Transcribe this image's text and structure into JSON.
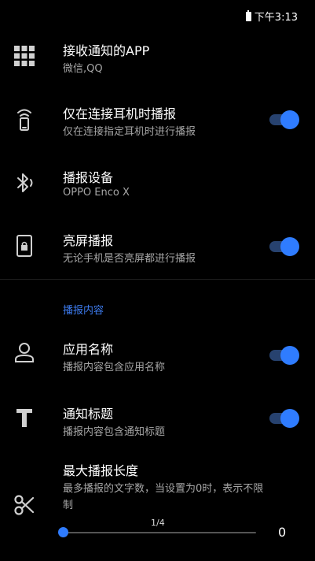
{
  "status_bar": {
    "time": "下午3:13"
  },
  "rows": {
    "apps": {
      "title": "接收通知的APP",
      "subtitle": "微信,QQ",
      "icon": "apps-grid-icon"
    },
    "headset_only": {
      "title": "仅在连接耳机时播报",
      "subtitle": "仅在连接指定耳机时进行播报",
      "icon": "headset-signal-icon",
      "enabled": true
    },
    "device": {
      "title": "播报设备",
      "subtitle": "OPPO Enco X",
      "icon": "bluetooth-icon"
    },
    "screen_on": {
      "title": "亮屏播报",
      "subtitle": "无论手机是否亮屏都进行播报",
      "icon": "phone-lock-icon",
      "enabled": true
    }
  },
  "section": {
    "title": "播报内容"
  },
  "content_rows": {
    "app_name": {
      "title": "应用名称",
      "subtitle": "播报内容包含应用名称",
      "icon": "person-icon",
      "enabled": true
    },
    "notif_title": {
      "title": "通知标题",
      "subtitle": "播报内容包含通知标题",
      "icon": "text-t-icon",
      "enabled": true
    },
    "max_length": {
      "title": "最大播报长度",
      "subtitle_line1": "最多播报的文字数，当设置为0时，表示不限",
      "subtitle_line2": "制",
      "icon": "scissors-icon",
      "slider_label": "1/4",
      "value": "0",
      "slider_fraction": 0
    }
  },
  "colors": {
    "accent": "#2f7cff",
    "track": "#27426f",
    "section": "#3d7cf0"
  }
}
